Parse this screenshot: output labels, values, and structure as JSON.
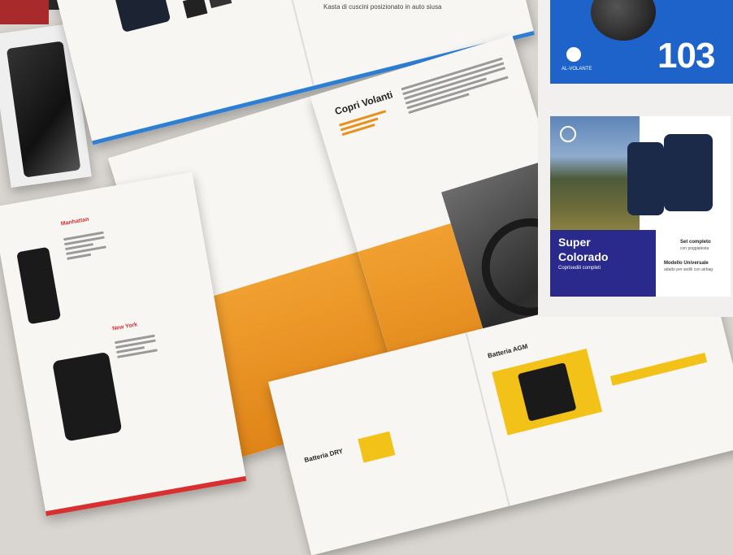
{
  "top_brochure": {
    "caption": "Kasta di cuscini posizionato in auto siusa"
  },
  "center_brochure": {
    "title": "Copri Volanti"
  },
  "left_brochure": {
    "title_one": "Manhattan",
    "title_two": "New York"
  },
  "bottom_brochure": {
    "title_left": "Batteria DRY",
    "title_right": "Batteria AGM"
  },
  "ad_blue": {
    "brand": "AL-VOLANTE",
    "number": "103"
  },
  "ad_colorado": {
    "title_line1": "Super",
    "title_line2": "Colorado",
    "subtitle": "Coprisedili completi",
    "info1_title": "Set completo",
    "info1_sub": "con poggiatesta",
    "info2_title": "Modello Universale",
    "info2_sub": "adatto per sedili con airbag"
  },
  "colors": {
    "background": "#d9d6d1",
    "orange": "#e8901c",
    "blue": "#1e63c9",
    "navy_panel": "#2a2a8c",
    "yellow": "#f3c218"
  }
}
